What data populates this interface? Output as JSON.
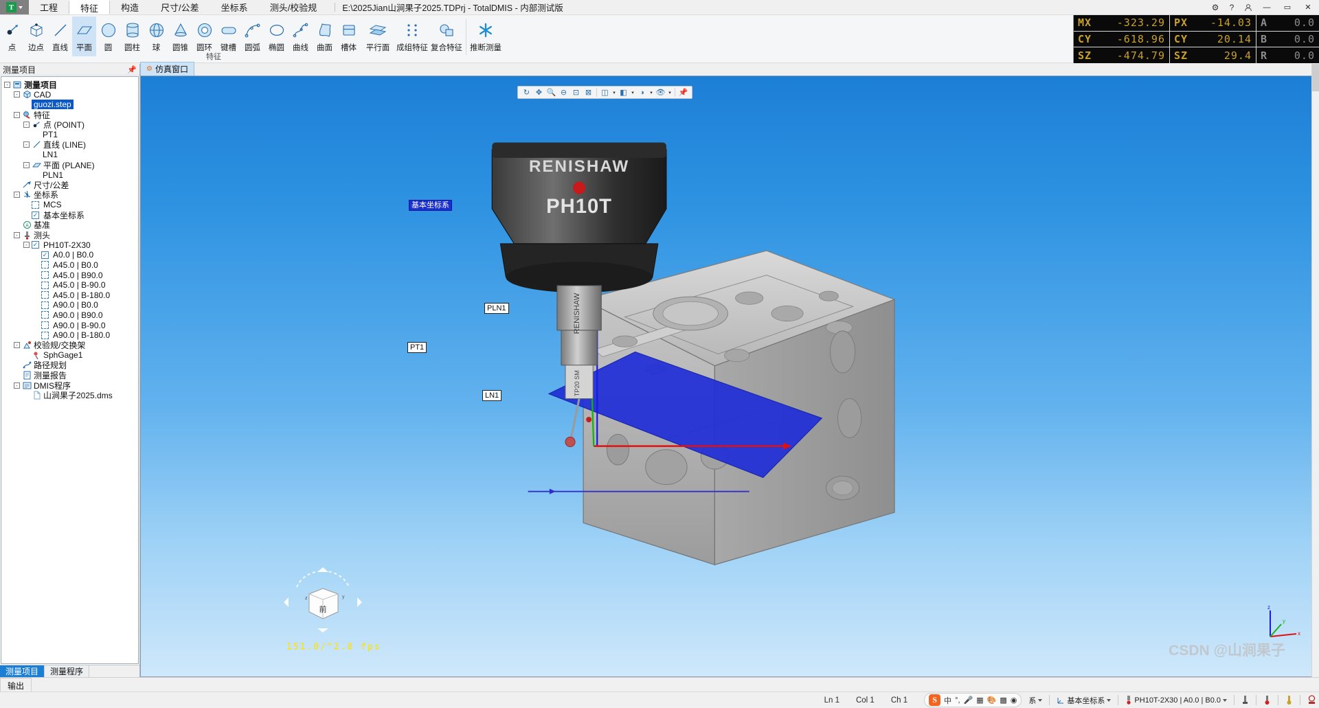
{
  "app": {
    "logo_letter": "T",
    "title": "E:\\2025Jian山涧果子2025.TDPrj - TotalDMIS - 内部测试版"
  },
  "menu": [
    {
      "label": "工程",
      "active": false
    },
    {
      "label": "特征",
      "active": true
    },
    {
      "label": "构造",
      "active": false
    },
    {
      "label": "尺寸/公差",
      "active": false
    },
    {
      "label": "坐标系",
      "active": false
    },
    {
      "label": "测头/校验规",
      "active": false
    }
  ],
  "titlebar_icons": [
    {
      "name": "settings-icon",
      "glyph": "⚙"
    },
    {
      "name": "help-icon",
      "glyph": "?"
    },
    {
      "name": "user-icon",
      "glyph": "👤"
    },
    {
      "name": "minimize-button",
      "glyph": "—"
    },
    {
      "name": "maximize-button",
      "glyph": "▭"
    },
    {
      "name": "close-button",
      "glyph": "✕"
    }
  ],
  "ribbon": {
    "group_label": "特征",
    "buttons": [
      {
        "label": "点",
        "icon": "point-icon",
        "selected": false
      },
      {
        "label": "边点",
        "icon": "edge-point-icon",
        "selected": false
      },
      {
        "label": "直线",
        "icon": "line-icon",
        "selected": false
      },
      {
        "label": "平面",
        "icon": "plane-icon",
        "selected": true
      },
      {
        "label": "圆",
        "icon": "circle-icon",
        "selected": false
      },
      {
        "label": "圆柱",
        "icon": "cylinder-icon",
        "selected": false
      },
      {
        "label": "球",
        "icon": "sphere-icon",
        "selected": false
      },
      {
        "label": "圆锥",
        "icon": "cone-icon",
        "selected": false
      },
      {
        "label": "圆环",
        "icon": "torus-icon",
        "selected": false
      },
      {
        "label": "键槽",
        "icon": "slot-icon",
        "selected": false
      },
      {
        "label": "圆弧",
        "icon": "arc-icon",
        "selected": false
      },
      {
        "label": "椭圆",
        "icon": "ellipse-icon",
        "selected": false
      },
      {
        "label": "曲线",
        "icon": "curve-icon",
        "selected": false
      },
      {
        "label": "曲面",
        "icon": "surface-icon",
        "selected": false
      },
      {
        "label": "槽体",
        "icon": "groove-body-icon",
        "selected": false
      },
      {
        "label": "平行面",
        "icon": "parallel-plane-icon",
        "selected": false
      },
      {
        "label": "成组特征",
        "icon": "group-feature-icon",
        "selected": false
      },
      {
        "label": "复合特征",
        "icon": "compound-feature-icon",
        "selected": false
      }
    ],
    "infer_button": {
      "label": "推断测量",
      "icon": "infer-measure-icon"
    }
  },
  "dro": {
    "rows": [
      {
        "m_label": "MX",
        "m_value": "-323.29",
        "p_label": "PX",
        "p_value": "-14.03",
        "a_label": "A",
        "a_value": "0.0"
      },
      {
        "m_label": "CY",
        "m_value": "-618.96",
        "p_label": "CY",
        "p_value": "20.14",
        "a_label": "B",
        "a_value": "0.0"
      },
      {
        "m_label": "SZ",
        "m_value": "-474.79",
        "p_label": "SZ",
        "p_value": "29.4",
        "a_label": "R",
        "a_value": "0.0"
      }
    ]
  },
  "left_panel": {
    "header": "测量项目",
    "pin_icon": "pin-icon",
    "tree": [
      {
        "depth": 0,
        "label": "测量项目",
        "icon": "project-icon",
        "expander": "-",
        "bold": true
      },
      {
        "depth": 1,
        "label": "CAD",
        "icon": "cad-icon",
        "expander": "-"
      },
      {
        "depth": 2,
        "label": "guozi.step",
        "icon": "none",
        "expander": "",
        "selected": true
      },
      {
        "depth": 1,
        "label": "特征",
        "icon": "feature-icon",
        "expander": "-"
      },
      {
        "depth": 2,
        "label": "点 (POINT)",
        "icon": "point-icon",
        "expander": "-"
      },
      {
        "depth": 3,
        "label": "PT1",
        "icon": "none",
        "expander": ""
      },
      {
        "depth": 2,
        "label": "直线 (LINE)",
        "icon": "line-icon",
        "expander": "-"
      },
      {
        "depth": 3,
        "label": "LN1",
        "icon": "none",
        "expander": ""
      },
      {
        "depth": 2,
        "label": "平面 (PLANE)",
        "icon": "plane-icon",
        "expander": "-"
      },
      {
        "depth": 3,
        "label": "PLN1",
        "icon": "none",
        "expander": ""
      },
      {
        "depth": 1,
        "label": "尺寸/公差",
        "icon": "tolerance-icon",
        "expander": ""
      },
      {
        "depth": 1,
        "label": "坐标系",
        "icon": "coordinate-system-icon",
        "expander": "-"
      },
      {
        "depth": 2,
        "label": "MCS",
        "icon": "none",
        "expander": "",
        "checkbox": "dashed"
      },
      {
        "depth": 2,
        "label": "基本坐标系",
        "icon": "none",
        "expander": "",
        "checkbox": "checked"
      },
      {
        "depth": 1,
        "label": "基准",
        "icon": "datum-icon",
        "expander": ""
      },
      {
        "depth": 1,
        "label": "测头",
        "icon": "probe-icon",
        "expander": "-"
      },
      {
        "depth": 2,
        "label": "PH10T-2X30",
        "icon": "none",
        "expander": "-",
        "checkbox": "checked"
      },
      {
        "depth": 3,
        "label": "A0.0 | B0.0",
        "icon": "none",
        "expander": "",
        "checkbox": "checked"
      },
      {
        "depth": 3,
        "label": "A45.0 | B0.0",
        "icon": "none",
        "expander": "",
        "checkbox": "dashed"
      },
      {
        "depth": 3,
        "label": "A45.0 | B90.0",
        "icon": "none",
        "expander": "",
        "checkbox": "dashed"
      },
      {
        "depth": 3,
        "label": "A45.0 | B-90.0",
        "icon": "none",
        "expander": "",
        "checkbox": "dashed"
      },
      {
        "depth": 3,
        "label": "A45.0 | B-180.0",
        "icon": "none",
        "expander": "",
        "checkbox": "dashed"
      },
      {
        "depth": 3,
        "label": "A90.0 | B0.0",
        "icon": "none",
        "expander": "",
        "checkbox": "dashed"
      },
      {
        "depth": 3,
        "label": "A90.0 | B90.0",
        "icon": "none",
        "expander": "",
        "checkbox": "dashed"
      },
      {
        "depth": 3,
        "label": "A90.0 | B-90.0",
        "icon": "none",
        "expander": "",
        "checkbox": "dashed"
      },
      {
        "depth": 3,
        "label": "A90.0 | B-180.0",
        "icon": "none",
        "expander": "",
        "checkbox": "dashed"
      },
      {
        "depth": 1,
        "label": "校验规/交换架",
        "icon": "gauge-icon",
        "expander": "-"
      },
      {
        "depth": 2,
        "label": "SphGage1",
        "icon": "sphere-gage-icon",
        "expander": ""
      },
      {
        "depth": 1,
        "label": "路径规划",
        "icon": "path-plan-icon",
        "expander": ""
      },
      {
        "depth": 1,
        "label": "测量报告",
        "icon": "report-icon",
        "expander": ""
      },
      {
        "depth": 1,
        "label": "DMIS程序",
        "icon": "dmis-icon",
        "expander": "-"
      },
      {
        "depth": 2,
        "label": "山涧果子2025.dms",
        "icon": "file-icon",
        "expander": ""
      }
    ],
    "tabs": [
      {
        "label": "测量项目",
        "active": true
      },
      {
        "label": "测量程序",
        "active": false
      }
    ],
    "output_tab": "输出"
  },
  "viewport": {
    "tab_label": "仿真窗口",
    "toolbar_icons": [
      "rotate-icon",
      "pan-icon",
      "zoom-in-icon",
      "zoom-out-icon",
      "zoom-fit-icon",
      "zoom-window-icon",
      "view-cube-icon",
      "shading-icon",
      "render-icon",
      "visibility-icon",
      "pin-icon"
    ],
    "scene_labels": [
      {
        "text": "基本坐标系",
        "style": "blue"
      },
      {
        "text": "PLN1",
        "style": "white"
      },
      {
        "text": "PT1",
        "style": "white"
      },
      {
        "text": "LN1",
        "style": "white"
      }
    ],
    "probe_head_text": "PH10T",
    "probe_brand_text": "RENISHAW",
    "nav_cube_label": "前",
    "fps": "151.0/^2.8 fps",
    "watermark": "CSDN @山涧果子"
  },
  "status_bar": {
    "ln": "Ln 1",
    "col": "Col 1",
    "ch": "Ch 1",
    "ime": {
      "logo": "S",
      "items": [
        "中",
        "°,",
        "mic-icon",
        "keyboard-icon",
        "skin-icon",
        "apps-icon",
        "browser-icon"
      ]
    },
    "coord_system_chip": "基本坐标系",
    "probe_chip": "PH10T-2X30 | A0.0 | B0.0",
    "trailing_icons": [
      "probe-status-icon",
      "alarm-icon",
      "temperature-icon",
      "machine-icon"
    ],
    "trailing_label": "系"
  }
}
